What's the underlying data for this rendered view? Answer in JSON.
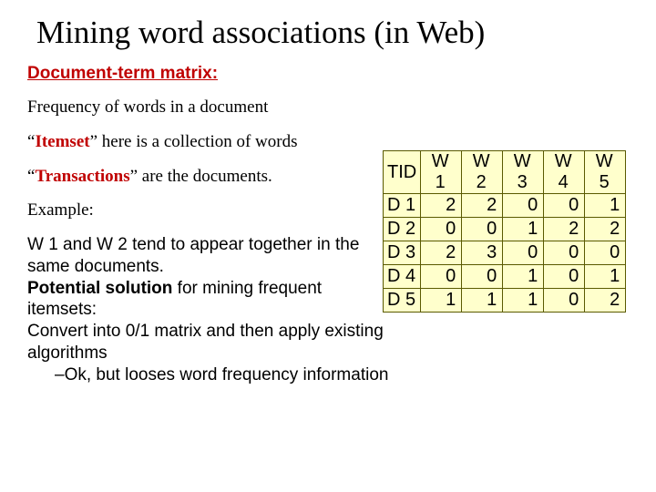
{
  "title": "Mining word associations (in Web)",
  "subheading": "Document-term matrix:",
  "freq_line": "Frequency of words in a document",
  "itemset": {
    "open_q": "“",
    "term": "Itemset",
    "close_q": "”",
    "rest": " here is a collection of words"
  },
  "transactions": {
    "open_q": "“",
    "term": "Transactions",
    "close_q": "”",
    "rest": " are the documents."
  },
  "example_label": "Example:",
  "example_body_1": "W 1 and W 2 tend to appear together in the same documents.",
  "potential_bold": "Potential solution",
  "potential_rest": " for mining frequent itemsets:",
  "convert_line": "Convert into 0/1 matrix and then apply existing algorithms",
  "ok_line": "–Ok, but looses word frequency information",
  "chart_data": {
    "type": "table",
    "title": "Document-term matrix",
    "columns": [
      "TID",
      "W 1",
      "W 2",
      "W 3",
      "W 4",
      "W 5"
    ],
    "rows": [
      {
        "id": "D 1",
        "values": [
          2,
          2,
          0,
          0,
          1
        ]
      },
      {
        "id": "D 2",
        "values": [
          0,
          0,
          1,
          2,
          2
        ]
      },
      {
        "id": "D 3",
        "values": [
          2,
          3,
          0,
          0,
          0
        ]
      },
      {
        "id": "D 4",
        "values": [
          0,
          0,
          1,
          0,
          1
        ]
      },
      {
        "id": "D 5",
        "values": [
          1,
          1,
          1,
          0,
          2
        ]
      }
    ]
  }
}
